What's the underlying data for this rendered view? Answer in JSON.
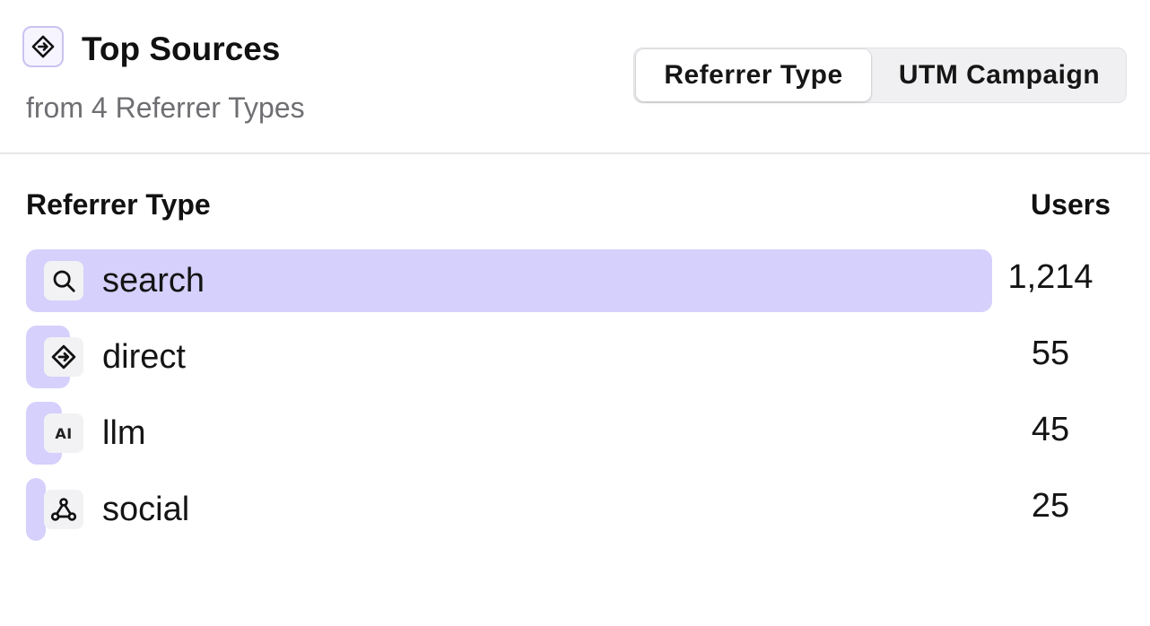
{
  "header": {
    "title": "Top Sources",
    "subtitle": "from 4 Referrer Types",
    "title_icon": "direction-diamond-icon",
    "tabs": [
      {
        "label": "Referrer Type",
        "active": true
      },
      {
        "label": "UTM Campaign",
        "active": false
      }
    ]
  },
  "table": {
    "columns": {
      "label": "Referrer Type",
      "value": "Users"
    },
    "bar_color": "#d6d0fc",
    "rows": [
      {
        "label": "search",
        "value": "1,214",
        "users": 1214,
        "icon": "search-icon"
      },
      {
        "label": "direct",
        "value": "55",
        "users": 55,
        "icon": "direction-diamond-icon"
      },
      {
        "label": "llm",
        "value": "45",
        "users": 45,
        "icon": "ai-icon",
        "icon_text": "AI"
      },
      {
        "label": "social",
        "value": "25",
        "users": 25,
        "icon": "share-nodes-icon"
      }
    ]
  }
}
